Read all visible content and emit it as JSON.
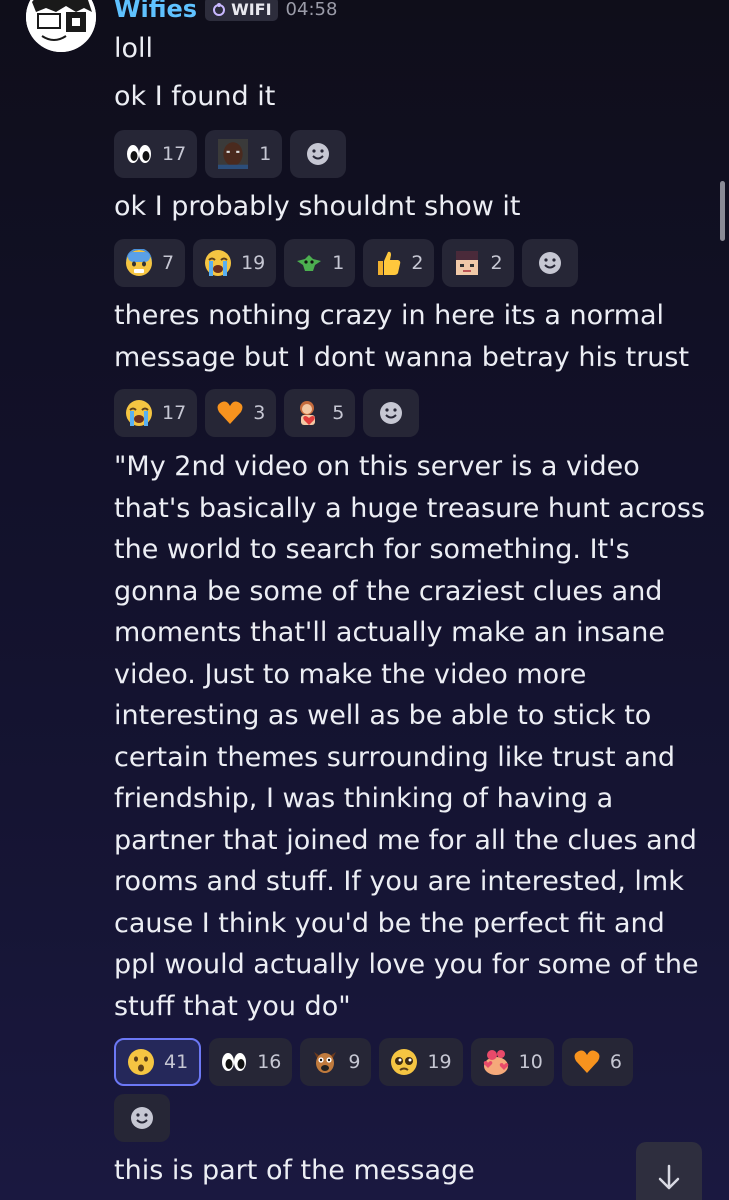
{
  "message": {
    "author": "Wifies",
    "tag": "WIFI",
    "time": "04:58",
    "lines": [
      "loll",
      "ok I found it",
      "ok I probably shouldnt show it"
    ],
    "paragraph1": "theres nothing crazy in here its a normal message but I dont wanna betray his trust",
    "quote": "\"My 2nd video on this server is a video that's basically a huge treasure hunt across the world to search for something. It's gonna be some of the craziest clues and moments that'll actually make an insane video. Just to make the video more interesting as well as be able to stick to certain themes surrounding like trust and friendship, I was thinking of having a partner that joined me for all the clues and rooms and stuff. If you are interested, lmk cause I think you'd be the perfect fit and ppl would actually love you for some of the stuff that you do\"",
    "last_line": "this is part of the message"
  },
  "reactions": {
    "group1": [
      {
        "icon": "eyes-emoji",
        "count": "17"
      },
      {
        "icon": "photo-emoji",
        "count": "1"
      }
    ],
    "group2": [
      {
        "icon": "cold-sweat-emoji",
        "count": "7"
      },
      {
        "icon": "sob-emoji",
        "count": "19"
      },
      {
        "icon": "alien-emoji",
        "count": "1"
      },
      {
        "icon": "thumbs-up-emoji",
        "count": "2"
      },
      {
        "icon": "character-emoji",
        "count": "2"
      }
    ],
    "group3": [
      {
        "icon": "sob-emoji",
        "count": "17"
      },
      {
        "icon": "orange-heart-emoji",
        "count": "3"
      },
      {
        "icon": "hug-emoji",
        "count": "5"
      }
    ],
    "group4": [
      {
        "icon": "hushed-emoji",
        "count": "41",
        "active": true
      },
      {
        "icon": "eyes-emoji",
        "count": "16"
      },
      {
        "icon": "dog-emoji",
        "count": "9"
      },
      {
        "icon": "pleading-emoji",
        "count": "19"
      },
      {
        "icon": "hearts-face-emoji",
        "count": "10"
      },
      {
        "icon": "orange-heart-emoji",
        "count": "6"
      }
    ]
  },
  "colors": {
    "username": "#5fc2ff",
    "pill": "#262636",
    "active_pill": "#25285a",
    "active_border": "#6c78f5"
  }
}
